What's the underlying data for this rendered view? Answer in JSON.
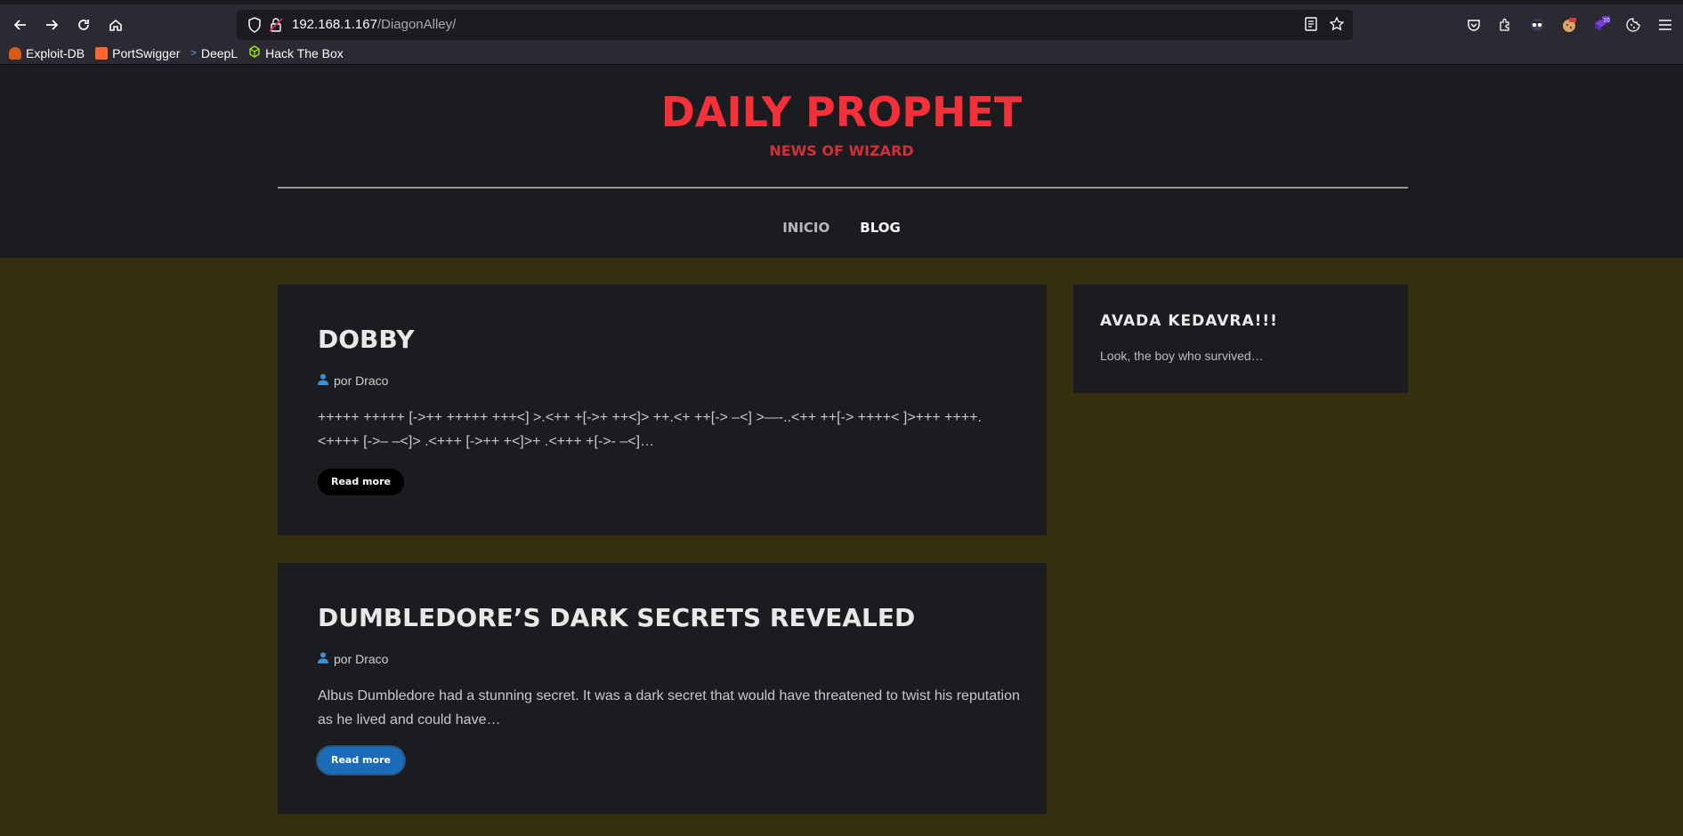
{
  "browser": {
    "url_host": "192.168.1.167",
    "url_path": "/DiagonAlley/",
    "extension_badge": "10",
    "bookmarks": [
      {
        "label": "Exploit-DB",
        "color": "#d65a1a"
      },
      {
        "label": "PortSwigger",
        "color": "#ff6633"
      },
      {
        "label": "DeepL",
        "color": "#0f2b46"
      },
      {
        "label": "Hack The Box",
        "color": "#9fef00"
      }
    ]
  },
  "site": {
    "title": "DAILY PROPHET",
    "tagline": "NEWS OF WIZARD",
    "nav": [
      {
        "label": "INICIO"
      },
      {
        "label": "BLOG"
      }
    ]
  },
  "posts": [
    {
      "title": "DOBBY",
      "author": "por Draco",
      "excerpt": "+++++ +++++ [->++ +++++ +++<] >.<++ +[->+ ++<]> ++.<+ ++[-> –<] >—-..<++ ++[-> ++++< ]>+++ ++++. <++++ [->– –<]> .<+++ [->++ +<]>+ .<+++ +[->- –<]…",
      "button": "Read more"
    },
    {
      "title": "DUMBLEDORE’S DARK SECRETS REVEALED",
      "author": "por Draco",
      "excerpt": "Albus Dumbledore had a stunning secret. It was a dark secret that would have threatened to twist his reputation as he lived and could have…",
      "button": "Read more"
    }
  ],
  "sidebar": {
    "title": "AVADA KEDAVRA!!!",
    "text": "Look, the boy who survived…"
  },
  "colors": {
    "brand_red": "#f4303b",
    "page_bg": "#352f10",
    "card_bg": "#1b1c1f",
    "author_icon": "#3a8fd9"
  }
}
